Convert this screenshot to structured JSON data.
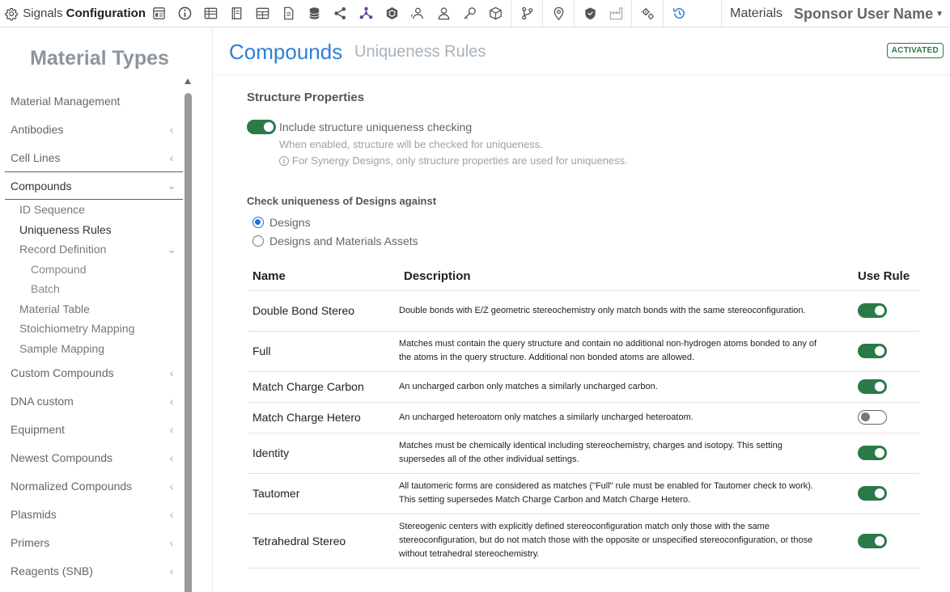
{
  "app": {
    "brand_prefix": "Signals",
    "brand_bold": "Configuration",
    "materials_label": "Materials",
    "user_name": "Sponsor User Name"
  },
  "toolbar_icons": [
    "layout-icon",
    "info-icon",
    "table-icon",
    "book-icon",
    "grid-table-icon",
    "document-icon",
    "database-icon",
    "share-icon",
    "molecule-icon",
    "hexagon-icon",
    "group-icon",
    "user-icon",
    "key-icon",
    "cube-icon",
    "git-branch-icon",
    "location-pin-icon",
    "shield-icon",
    "factory-icon",
    "settings-gears-icon",
    "history-icon"
  ],
  "colors": {
    "accent": "#2f7fd6",
    "toggle_on": "#2a7a47",
    "badge": "#2a7a47",
    "nav_active_border": "#3a6f7a"
  },
  "sidebar": {
    "title": "Material Types",
    "items": [
      {
        "label": "Material Management",
        "chevron": ""
      },
      {
        "label": "Antibodies",
        "chevron": "‹"
      },
      {
        "label": "Cell Lines",
        "chevron": "‹"
      },
      {
        "label": "Compounds",
        "chevron": "⌄"
      }
    ],
    "compound_subitems": [
      {
        "label": "ID Sequence"
      },
      {
        "label": "Uniqueness Rules"
      },
      {
        "label": "Record Definition",
        "chevron": "⌄"
      }
    ],
    "record_subitems": [
      {
        "label": "Compound"
      },
      {
        "label": "Batch"
      }
    ],
    "compound_subitems_after": [
      {
        "label": "Material Table"
      },
      {
        "label": "Stoichiometry Mapping"
      },
      {
        "label": "Sample Mapping"
      }
    ],
    "items_after": [
      {
        "label": "Custom Compounds",
        "chevron": "‹"
      },
      {
        "label": "DNA custom",
        "chevron": "‹"
      },
      {
        "label": "Equipment",
        "chevron": "‹"
      },
      {
        "label": "Newest Compounds",
        "chevron": "‹"
      },
      {
        "label": "Normalized Compounds",
        "chevron": "‹"
      },
      {
        "label": "Plasmids",
        "chevron": "‹"
      },
      {
        "label": "Primers",
        "chevron": "‹"
      },
      {
        "label": "Reagents (SNB)",
        "chevron": "‹"
      }
    ]
  },
  "main": {
    "title": "Compounds",
    "subtitle": "Uniqueness Rules",
    "status_badge": "ACTIVATED",
    "structure": {
      "section_title": "Structure Properties",
      "toggle_label": "Include structure uniqueness checking",
      "toggle_on": true,
      "note1": "When enabled, structure will be checked for uniqueness.",
      "note2": "For Synergy Designs, only structure properties are used for uniqueness."
    },
    "check": {
      "title": "Check uniqueness of Designs against",
      "options": [
        {
          "label": "Designs",
          "selected": true
        },
        {
          "label": "Designs and Materials Assets",
          "selected": false
        }
      ]
    },
    "table": {
      "headers": {
        "name": "Name",
        "description": "Description",
        "use_rule": "Use Rule"
      },
      "rows": [
        {
          "name": "Double Bond Stereo",
          "description": "Double bonds with E/Z geometric stereochemistry only match bonds with the same stereoconfiguration.",
          "use_rule": true
        },
        {
          "name": "Full",
          "description": "Matches must contain the query structure and contain no additional non-hydrogen atoms bonded to any of the atoms in the query structure. Additional non bonded atoms are allowed.",
          "use_rule": true
        },
        {
          "name": "Match Charge Carbon",
          "description": "An uncharged carbon only matches a similarly uncharged carbon.",
          "use_rule": true
        },
        {
          "name": "Match Charge Hetero",
          "description": "An uncharged heteroatom only matches a similarly uncharged heteroatom.",
          "use_rule": false
        },
        {
          "name": "Identity",
          "description": "Matches must be chemically identical including stereochemistry, charges and isotopy. This setting supersedes all of the other individual settings.",
          "use_rule": true
        },
        {
          "name": "Tautomer",
          "description": "All tautomeric forms are considered as matches (\"Full\" rule must be enabled for Tautomer check to work). This setting supersedes Match Charge Carbon and Match Charge Hetero.",
          "use_rule": true
        },
        {
          "name": "Tetrahedral Stereo",
          "description": "Stereogenic centers with explicitly defined stereoconfiguration match only those with the same stereoconfiguration, but do not match those with the opposite or unspecified stereoconfiguration, or those without tetrahedral stereochemistry.",
          "use_rule": true
        }
      ]
    }
  }
}
